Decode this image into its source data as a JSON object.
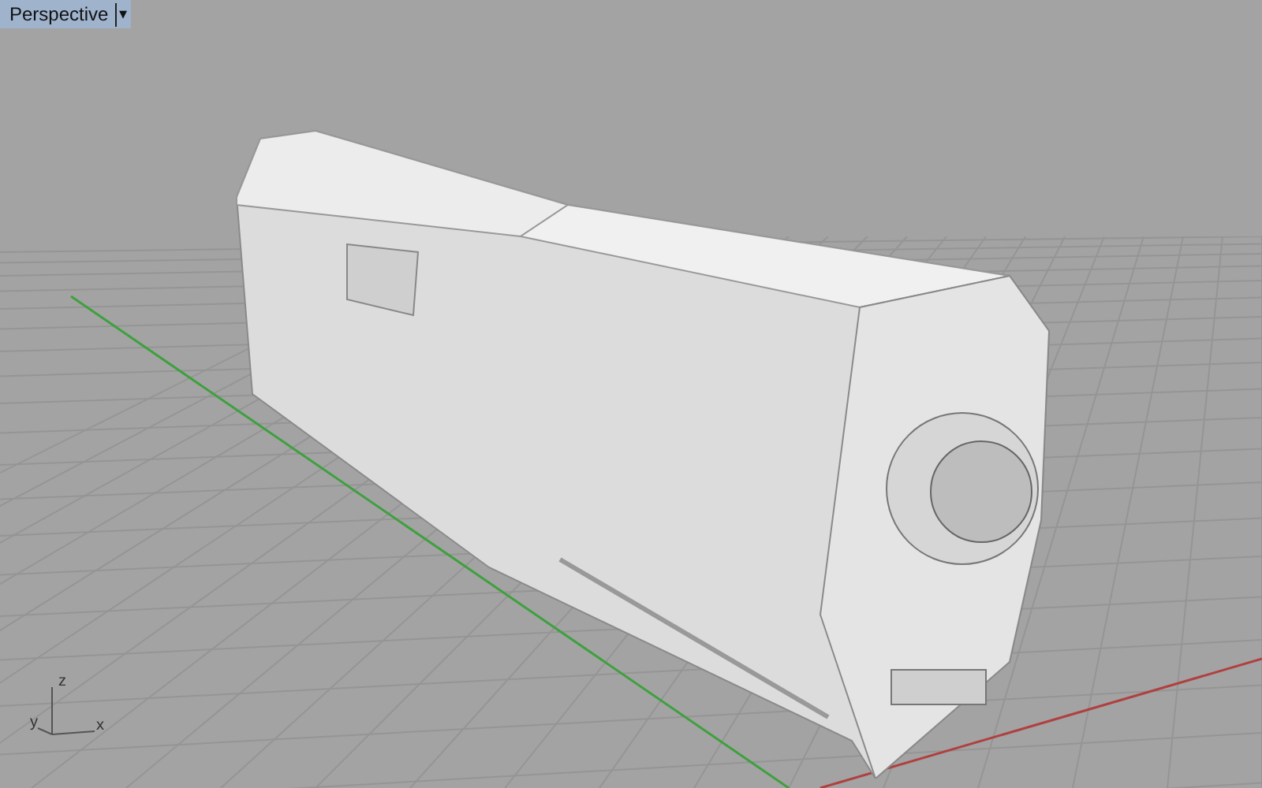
{
  "viewport": {
    "title": "Perspective",
    "menu_glyph": "▾"
  },
  "axes": {
    "z": "z",
    "y": "y",
    "x": "x"
  }
}
